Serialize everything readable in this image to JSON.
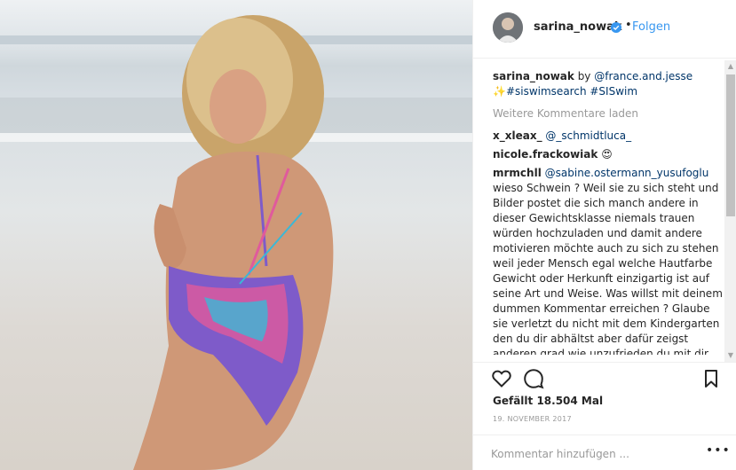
{
  "post": {
    "image_alt": ""
  },
  "header": {
    "username": "sarina_nowak",
    "separator": "•",
    "follow_label": "Folgen"
  },
  "caption": {
    "username": "sarina_nowak",
    "by": " by ",
    "mention": "@france.and.jesse",
    "sparkle": "✨",
    "hashtag1": "#siswimsearch",
    "hashtag2": "#SISwim"
  },
  "load_more": "Weitere Kommentare laden",
  "comments": [
    {
      "username": "x_xleax_",
      "mention": "@_schmidtluca_",
      "text": ""
    },
    {
      "username": "nicole.frackowiak",
      "mention": "",
      "text": "😍"
    },
    {
      "username": "mrmchll",
      "mention": "@sabine.ostermann_yusufoglu",
      "text": "wieso Schwein ? Weil sie zu sich steht und Bilder postet die sich manch andere in dieser Gewichtsklasse niemals trauen würden hochzuladen und damit andere motivieren möchte auch zu sich zu stehen weil jeder Mensch egal welche Hautfarbe Gewicht oder Herkunft einzigartig ist auf seine Art und Weise. Was willst mit deinem dummen Kommentar erreichen ? Glaube sie verletzt du nicht mit dem Kindergarten den du dir abhältst aber dafür zeigst anderen grad wie unzufrieden du mit dir selbst bist"
    }
  ],
  "likes": "Gefällt 18.504 Mal",
  "date": "19. NOVEMBER 2017",
  "add_comment_placeholder": "Kommentar hinzufügen ...",
  "more_options": "•••",
  "icons": {
    "like": "heart-icon",
    "comment": "speech-bubble-icon",
    "save": "bookmark-icon",
    "verified": "verified-badge-icon"
  },
  "colors": {
    "link": "#003569",
    "follow": "#3897f0",
    "muted": "#999999"
  }
}
